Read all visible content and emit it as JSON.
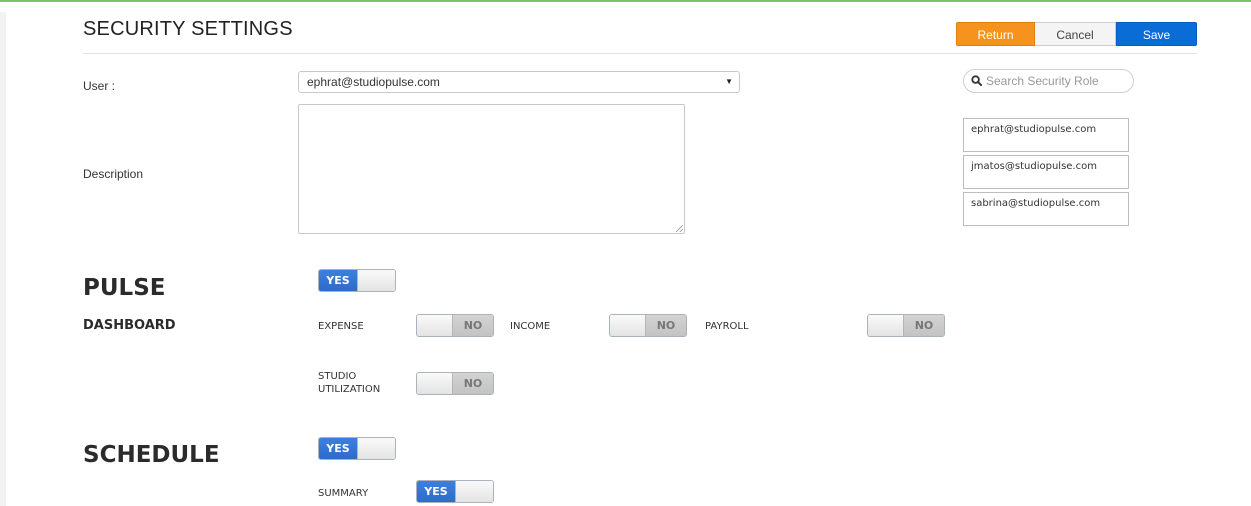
{
  "page": {
    "title": "SECURITY SETTINGS"
  },
  "toolbar": {
    "return_label": "Return",
    "cancel_label": "Cancel",
    "save_label": "Save"
  },
  "form": {
    "user_label": "User :",
    "user_value": "ephrat@studiopulse.com",
    "description_label": "Description",
    "description_value": ""
  },
  "search": {
    "placeholder": "Search Security Role"
  },
  "roles": [
    "ephrat@studiopulse.com",
    "jmatos@studiopulse.com",
    "sabrina@studiopulse.com"
  ],
  "sections": {
    "pulse": {
      "title": "PULSE",
      "toggle": "YES"
    },
    "dashboard": {
      "title": "DASHBOARD",
      "expense": {
        "label": "EXPENSE",
        "toggle": "NO"
      },
      "income": {
        "label": "INCOME",
        "toggle": "NO"
      },
      "payroll": {
        "label": "PAYROLL",
        "toggle": "NO"
      },
      "studio_utilization": {
        "label_line1": "STUDIO",
        "label_line2": "UTILIZATION",
        "toggle": "NO"
      }
    },
    "schedule": {
      "title": "SCHEDULE",
      "toggle": "YES",
      "summary": {
        "label": "SUMMARY",
        "toggle": "YES"
      }
    }
  },
  "colors": {
    "return": "#f6931f",
    "save": "#0a6cd6",
    "toggle_on": "#3d7fe0",
    "top_accent": "#7cc36b"
  }
}
